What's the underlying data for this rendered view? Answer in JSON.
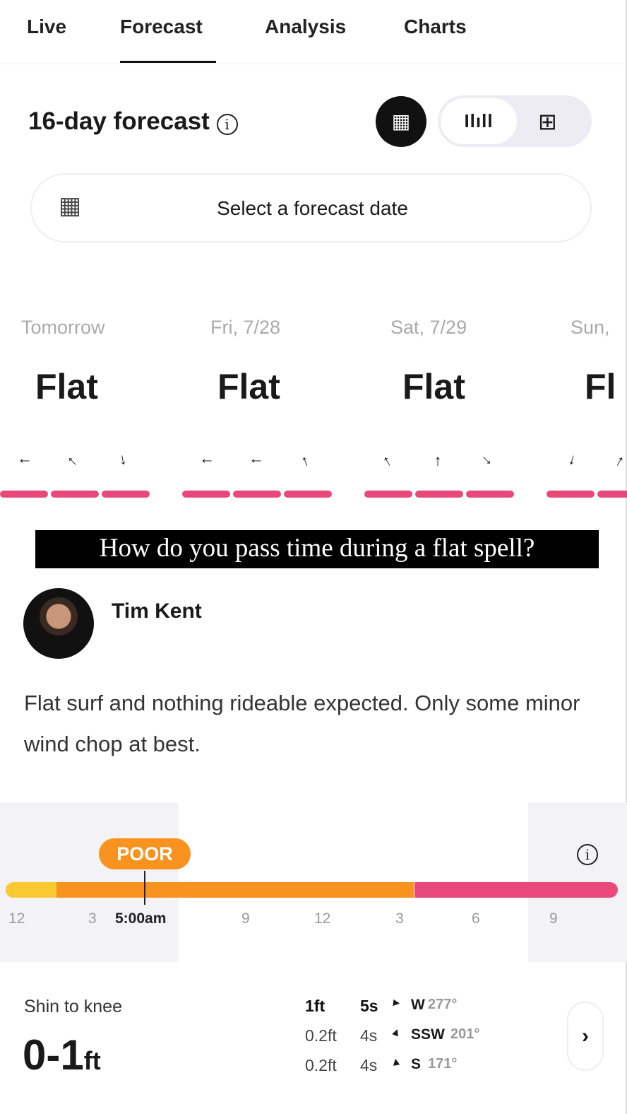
{
  "tabs": [
    {
      "label": "Live"
    },
    {
      "label": "Forecast",
      "active": true
    },
    {
      "label": "Analysis"
    },
    {
      "label": "Charts"
    }
  ],
  "header": {
    "title": "16-day forecast",
    "info_icon": "info-icon",
    "view_modes": [
      "calendar-icon",
      "bar-chart-icon",
      "grid-icon"
    ],
    "active_view": "bar-chart"
  },
  "date_picker": {
    "label": "Select a forecast date",
    "icon": "calendar-icon"
  },
  "days": [
    {
      "label": "Tomorrow",
      "condition": "Flat",
      "wind_dirs_deg": [
        270,
        315,
        170
      ]
    },
    {
      "label": "Fri, 7/28",
      "condition": "Flat",
      "wind_dirs_deg": [
        270,
        270,
        340
      ]
    },
    {
      "label": "Sat, 7/29",
      "condition": "Flat",
      "wind_dirs_deg": [
        330,
        0,
        135
      ]
    },
    {
      "label": "Sun,",
      "condition": "Fl",
      "wind_dirs_deg": [
        195,
        30
      ]
    }
  ],
  "rating_color": "#e8497a",
  "banner": "How do you pass time during a flat spell?",
  "forecaster": {
    "name": "Tim Kent",
    "note": "Flat surf and nothing rideable expected. Only some minor wind chop at best."
  },
  "timeline": {
    "badge": "POOR",
    "badge_color": "#f7931e",
    "current_time": "5:00am",
    "labels": [
      "12",
      "3",
      "9",
      "12",
      "3",
      "6",
      "9"
    ],
    "colors": {
      "fair": "#f9c932",
      "poor": "#f7931e",
      "very_poor": "#e8497a"
    }
  },
  "surf": {
    "description": "Shin to knee",
    "height": "0-1",
    "unit": "ft",
    "swells": [
      {
        "height": "1ft",
        "period": "5s",
        "dir": "W",
        "deg": "277°",
        "rot": 277
      },
      {
        "height": "0.2ft",
        "period": "4s",
        "dir": "SSW",
        "deg": "201°",
        "rot": 201
      },
      {
        "height": "0.2ft",
        "period": "4s",
        "dir": "S",
        "deg": "171°",
        "rot": 171
      }
    ],
    "next_icon": "chevron-right-icon"
  }
}
